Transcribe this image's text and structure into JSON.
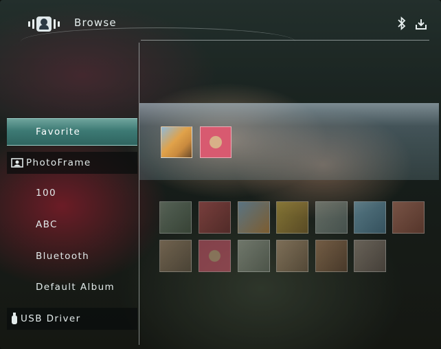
{
  "header": {
    "title": "Browse"
  },
  "sidebar": {
    "items": [
      {
        "label": "Favorite",
        "selected": true,
        "kind": "album"
      },
      {
        "label": "PhotoFrame",
        "kind": "section",
        "icon": "photo-frame-icon"
      },
      {
        "label": "100",
        "kind": "album"
      },
      {
        "label": "ABC",
        "kind": "album"
      },
      {
        "label": "Bluetooth",
        "kind": "album"
      },
      {
        "label": "Default Album",
        "kind": "album"
      },
      {
        "label": "USB Driver",
        "kind": "section",
        "icon": "usb-icon"
      }
    ]
  },
  "status_icons": [
    "bluetooth-icon",
    "download-icon"
  ],
  "favorite_thumbnails": [
    {
      "name": "thumb-dog-sunflowers",
      "color": "#c98a3e"
    },
    {
      "name": "thumb-dog-pink-flowers",
      "color": "#d85a70"
    }
  ],
  "grid_thumbnails": [
    {
      "name": "thumb-1",
      "color": "#6b7d67"
    },
    {
      "name": "thumb-2",
      "color": "#b84848"
    },
    {
      "name": "thumb-3",
      "color": "#c98a3e"
    },
    {
      "name": "thumb-4",
      "color": "#c9a43a"
    },
    {
      "name": "thumb-5",
      "color": "#7f8f8a"
    },
    {
      "name": "thumb-6",
      "color": "#5f8fa8"
    },
    {
      "name": "thumb-7",
      "color": "#b05c4c"
    },
    {
      "name": "thumb-8",
      "color": "#9c7a5e"
    },
    {
      "name": "thumb-9",
      "color": "#d85a70"
    },
    {
      "name": "thumb-10",
      "color": "#8a9080"
    },
    {
      "name": "thumb-11",
      "color": "#a88a6a"
    },
    {
      "name": "thumb-12",
      "color": "#9a6a50"
    },
    {
      "name": "thumb-13",
      "color": "#8a7a70"
    }
  ],
  "colors": {
    "accent": "#3d7a74",
    "text": "#e2eaea"
  }
}
